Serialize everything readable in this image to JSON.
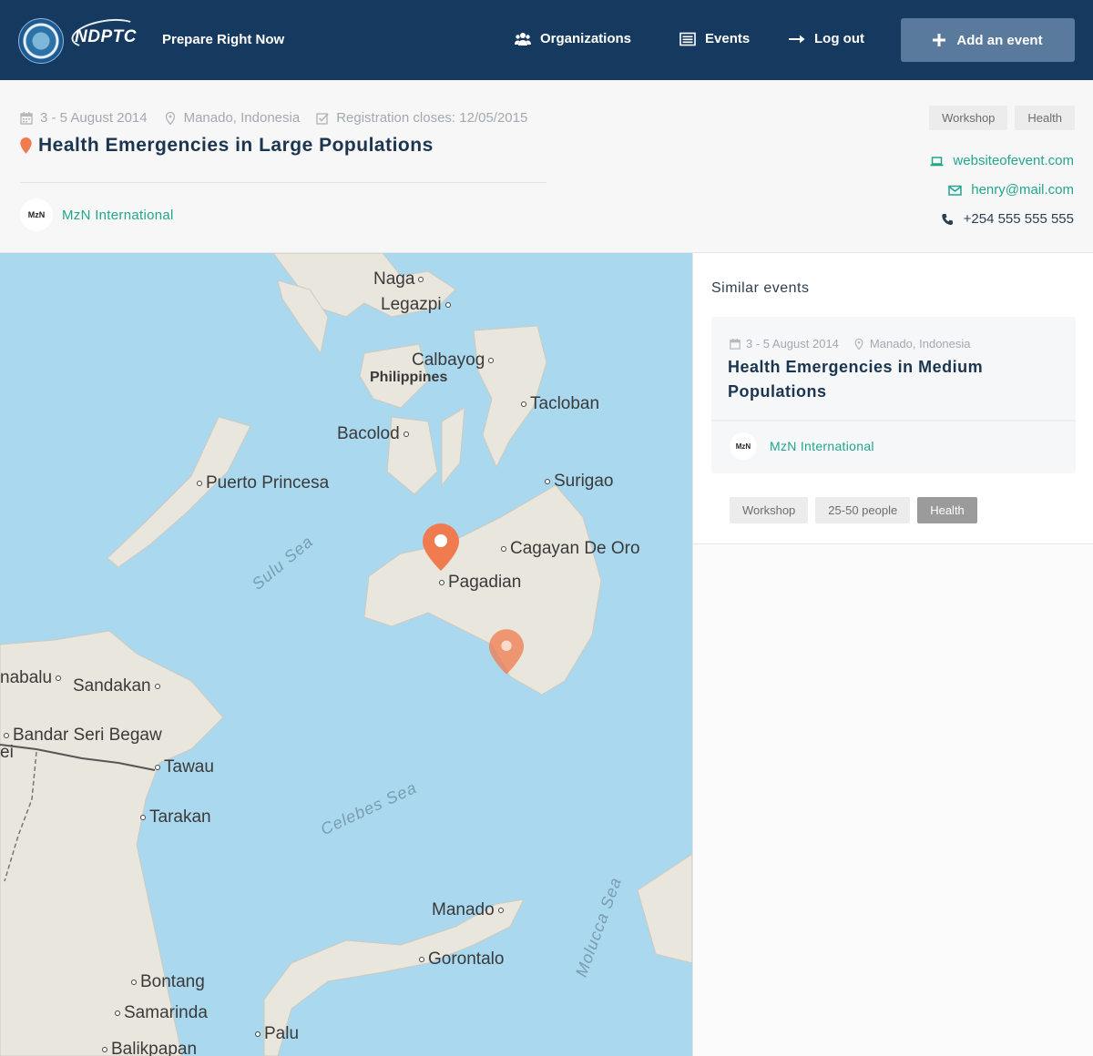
{
  "header": {
    "logo_text": "NDPTC",
    "tagline": "Prepare Right Now",
    "nav": {
      "organizations": "Organizations",
      "events": "Events",
      "logout": "Log out"
    },
    "add_event_label": "Add an event"
  },
  "event": {
    "date": "3 - 5 August 2014",
    "location": "Manado, Indonesia",
    "registration": "Registration closes: 12/05/2015",
    "title": "Health Emergencies in Large Populations",
    "organization": "MzN International",
    "org_logo_text": "MzN",
    "tags": [
      "Workshop",
      "Health"
    ],
    "website": "websiteofevent.com",
    "email": "henry@mail.com",
    "phone": "+254 555 555 555"
  },
  "map": {
    "cities": {
      "naga": "Naga",
      "legazpi": "Legazpi",
      "calbayog": "Calbayog",
      "philippines": "Philippines",
      "tacloban": "Tacloban",
      "bacolod": "Bacolod",
      "puerto_princesa": "Puerto Princesa",
      "surigao": "Surigao",
      "cagayan": "Cagayan De Oro",
      "pagadian": "Pagadian",
      "kinabalu": "nabalu",
      "sandakan": "Sandakan",
      "bandar": "Bandar Seri Begaw",
      "tawau": "Tawau",
      "tarakan": "Tarakan",
      "manado": "Manado",
      "gorontalo": "Gorontalo",
      "bontang": "Bontang",
      "samarinda": "Samarinda",
      "palu": "Palu",
      "balikpapan": "Balikpapan",
      "ei": "ei"
    },
    "seas": {
      "sulu": "Sulu Sea",
      "celebes": "Celebes Sea",
      "molucca": "Molucca Sea"
    },
    "colors": {
      "water": "#a9d8ef",
      "land": "#e9e6dd",
      "pin": "#f07b4f"
    }
  },
  "similar": {
    "heading": "Similar events",
    "items": [
      {
        "date": "3 - 5 August 2014",
        "location": "Manado, Indonesia",
        "title": "Health Emergencies in Medium Populations",
        "organization": "MzN International",
        "org_logo_text": "MzN"
      }
    ],
    "filters": [
      "Workshop",
      "25-50 people",
      "Health"
    ],
    "active_filter": "Health"
  }
}
